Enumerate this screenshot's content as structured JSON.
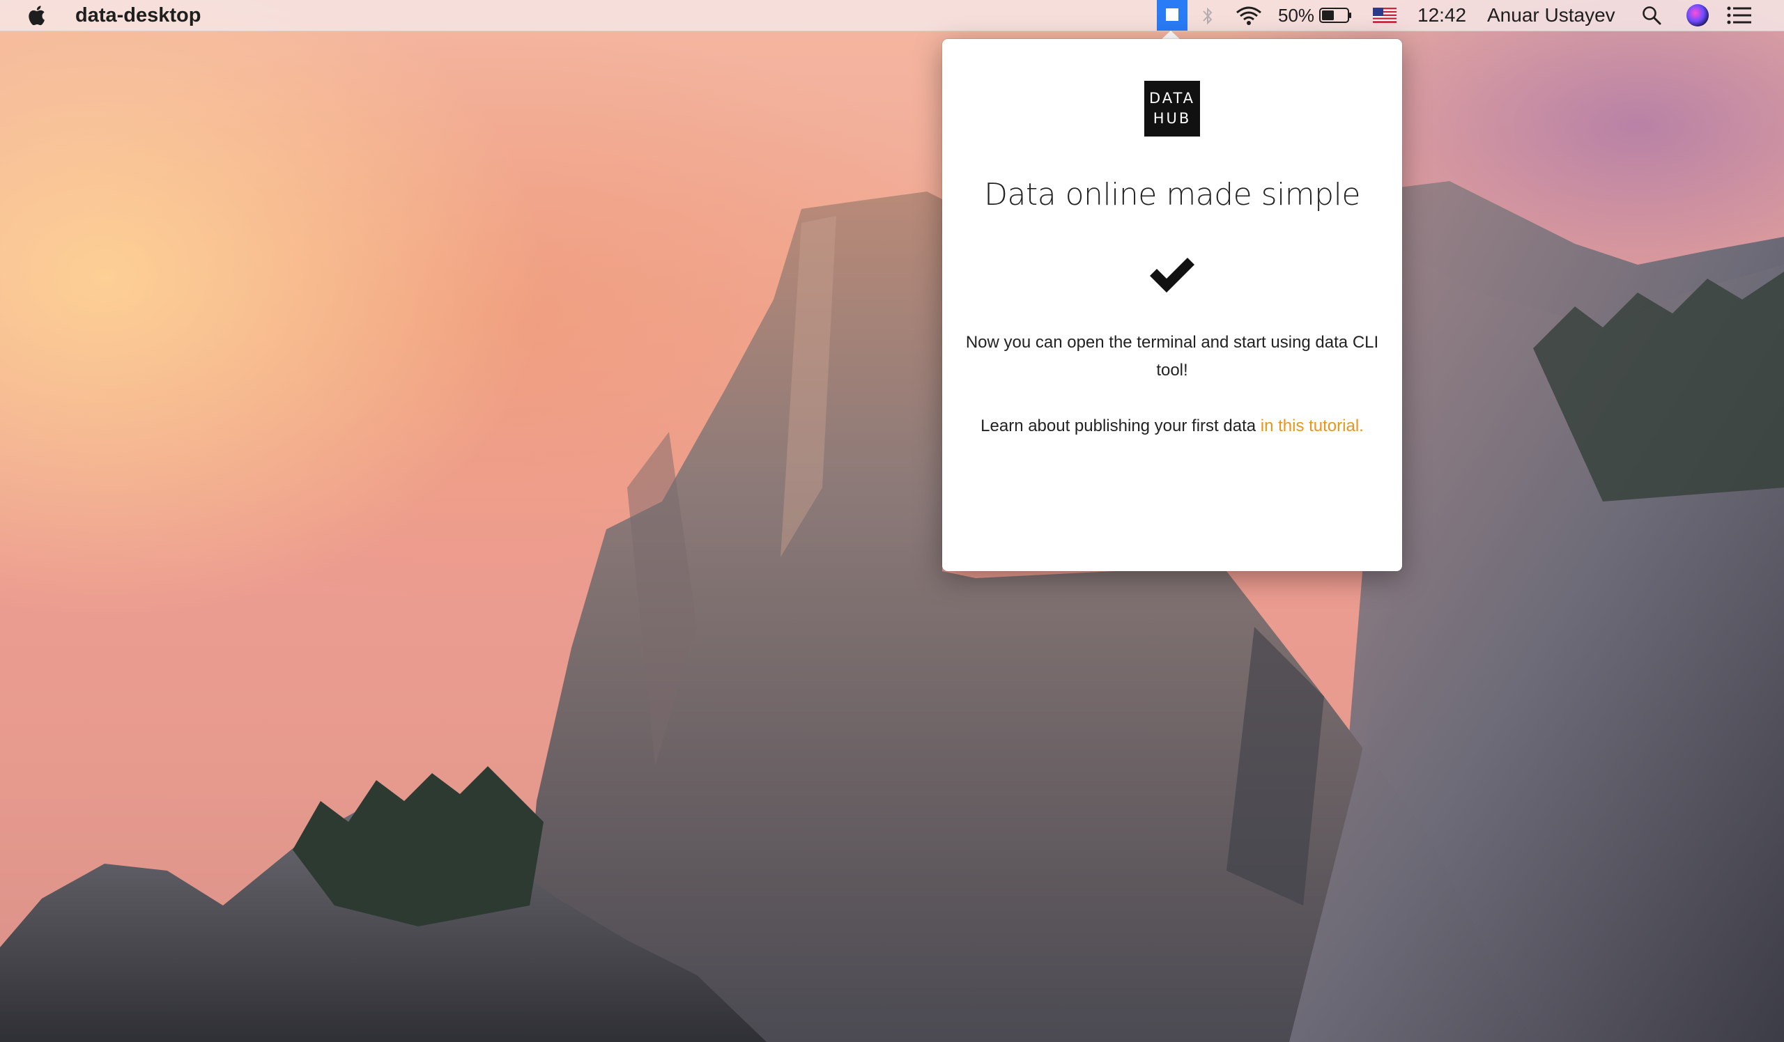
{
  "menubar": {
    "app_name": "data-desktop",
    "battery_percent": "50%",
    "clock": "12:42",
    "user_name": "Anuar Ustayev",
    "icons": [
      "apple-icon",
      "app-indicator-icon",
      "bluetooth-icon",
      "wifi-icon",
      "battery-icon",
      "us-flag-icon",
      "search-icon",
      "siri-icon",
      "notification-center-icon"
    ],
    "accent_color": "#2a7bf6"
  },
  "popover": {
    "logo_line1": "DATA",
    "logo_line2": "HUB",
    "headline": "Data online made simple",
    "status_icon": "checkmark-icon",
    "message": "Now you can open the terminal and start using data CLI tool!",
    "tutorial_prefix": "Learn about publishing your first data ",
    "tutorial_link": "in this tutorial.",
    "link_color": "#e8961a"
  }
}
